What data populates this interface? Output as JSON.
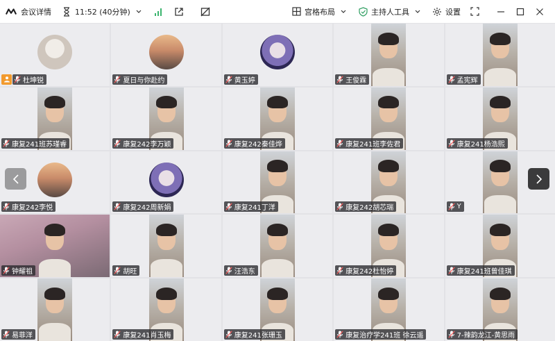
{
  "toolbar": {
    "logo_icon": "meeting-logo-icon",
    "meeting_details": "会议详情",
    "timer_icon": "hourglass-icon",
    "time": "11:52 (40分钟)",
    "layout_label": "宫格布局",
    "host_tools_label": "主持人工具",
    "settings_label": "设置"
  },
  "colors": {
    "host_badge": "#f29a2e",
    "signal": "#3bb46e",
    "toolbar_bg": "#ffffff",
    "tile_bg": "#ececef"
  },
  "tiles": [
    {
      "name": "杜坤锐",
      "type": "avatar",
      "host": true
    },
    {
      "name": "夏日与你赴约",
      "type": "avatar"
    },
    {
      "name": "黄玉婷",
      "type": "avatar"
    },
    {
      "name": "王俊霖",
      "type": "video"
    },
    {
      "name": "孟宪辉",
      "type": "video"
    },
    {
      "name": "康复241班苏瑾睿",
      "type": "video"
    },
    {
      "name": "康复242李万颖",
      "type": "video"
    },
    {
      "name": "康复242秦佳烨",
      "type": "video"
    },
    {
      "name": "康复241班李佐君",
      "type": "video"
    },
    {
      "name": "康复241杨浩熙",
      "type": "video"
    },
    {
      "name": "康复242李悦",
      "type": "avatar"
    },
    {
      "name": "康复242周新娟",
      "type": "avatar"
    },
    {
      "name": "康复241丁洋",
      "type": "video"
    },
    {
      "name": "康复242胡芯瑞",
      "type": "video"
    },
    {
      "name": "Y",
      "type": "video"
    },
    {
      "name": "钟耀祖",
      "type": "video-wide"
    },
    {
      "name": "胡旺",
      "type": "video"
    },
    {
      "name": "汪浩东",
      "type": "video"
    },
    {
      "name": "康复242杜怡婷",
      "type": "video"
    },
    {
      "name": "康复241班曾佳琪",
      "type": "video"
    },
    {
      "name": "易菲洋",
      "type": "video"
    },
    {
      "name": "康复241肖玉梅",
      "type": "video"
    },
    {
      "name": "康复241张珊玉",
      "type": "video"
    },
    {
      "name": "康复治疗学241班 徐云遥",
      "type": "video"
    },
    {
      "name": "7-辣韵龙江-黄思雨",
      "type": "video"
    }
  ]
}
